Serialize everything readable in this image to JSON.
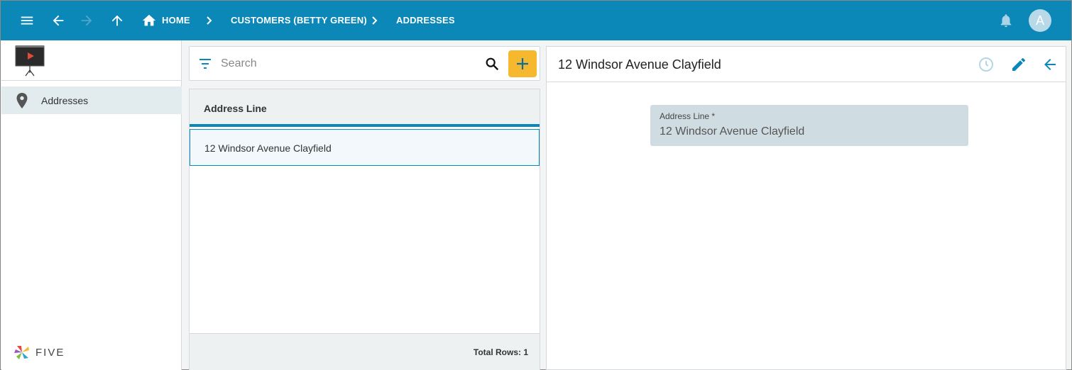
{
  "topbar": {
    "breadcrumbs": [
      "HOME",
      "CUSTOMERS (BETTY GREEN)",
      "ADDRESSES"
    ],
    "avatar_letter": "A"
  },
  "sidebar": {
    "items": [
      {
        "label": "Addresses",
        "icon": "map-pin-icon"
      }
    ],
    "brand": "FIVE"
  },
  "list": {
    "search_placeholder": "Search",
    "column_header": "Address Line",
    "rows": [
      "12 Windsor Avenue Clayfield"
    ],
    "total_rows_label": "Total Rows: 1"
  },
  "detail": {
    "title": "12 Windsor Avenue Clayfield",
    "field_label": "Address Line *",
    "field_value": "12 Windsor Avenue Clayfield"
  },
  "colors": {
    "primary": "#0b87b8",
    "add_button": "#f5b82e",
    "field_bg": "#cfdde2"
  }
}
